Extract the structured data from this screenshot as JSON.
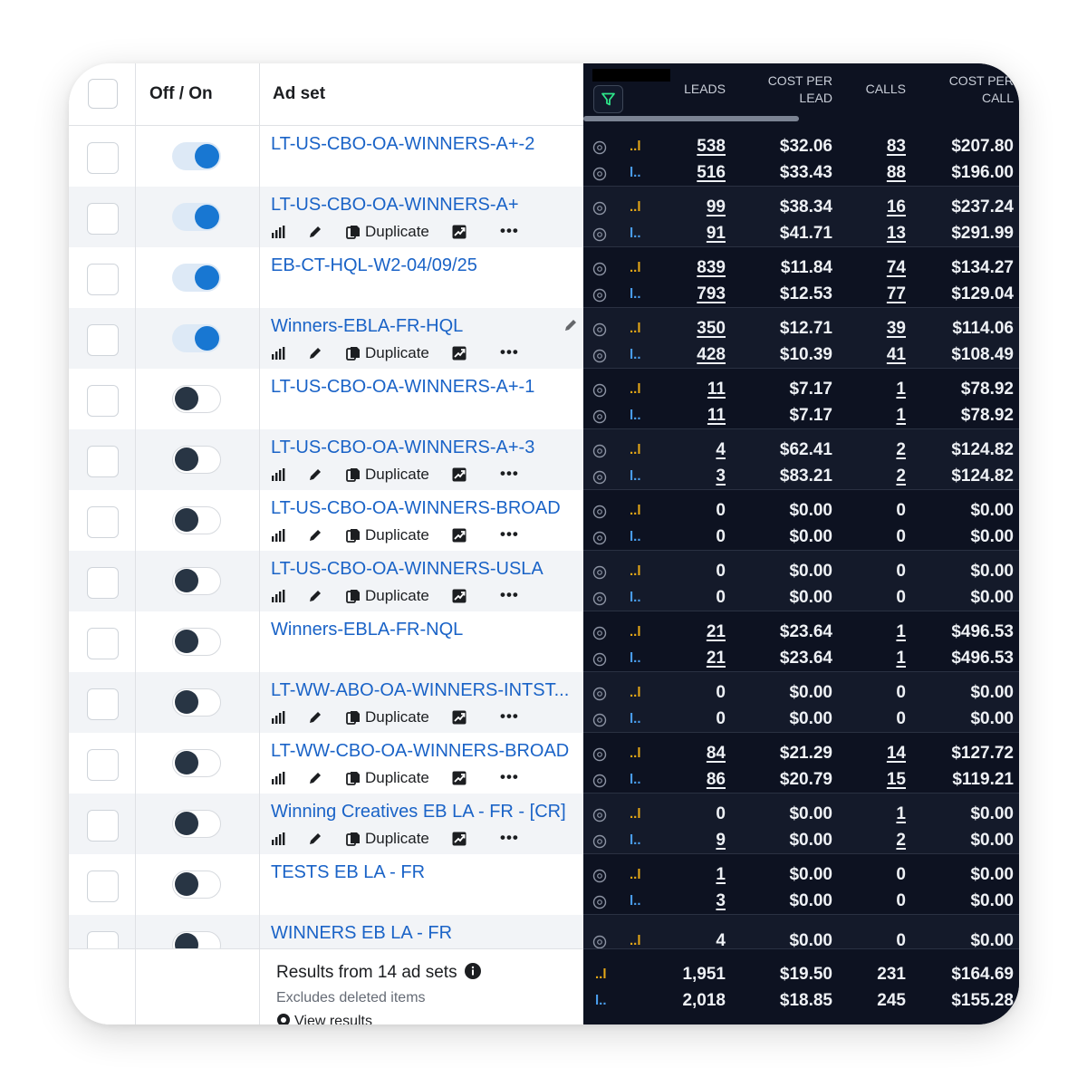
{
  "header": {
    "col_toggle": "Off / On",
    "col_adset": "Ad set",
    "col_leads": "LEADS",
    "col_cpl": [
      "COST PER",
      "LEAD"
    ],
    "col_calls": "CALLS",
    "col_cpc": [
      "COST PER",
      "CALL"
    ]
  },
  "actions": {
    "duplicate": "Duplicate",
    "more": "•••"
  },
  "legend": {
    "a": "..l",
    "b": "l.."
  },
  "rows": [
    {
      "name": "LT-US-CBO-OA-WINNERS-A+-2",
      "on": true,
      "tools": false,
      "a": {
        "leads": "538",
        "cpl": "$32.06",
        "calls": "83",
        "cpc": "$207.80"
      },
      "b": {
        "leads": "516",
        "cpl": "$33.43",
        "calls": "88",
        "cpc": "$196.00"
      }
    },
    {
      "name": "LT-US-CBO-OA-WINNERS-A+",
      "on": true,
      "tools": true,
      "a": {
        "leads": "99",
        "cpl": "$38.34",
        "calls": "16",
        "cpc": "$237.24"
      },
      "b": {
        "leads": "91",
        "cpl": "$41.71",
        "calls": "13",
        "cpc": "$291.99"
      }
    },
    {
      "name": "EB-CT-HQL-W2-04/09/25",
      "on": true,
      "tools": false,
      "a": {
        "leads": "839",
        "cpl": "$11.84",
        "calls": "74",
        "cpc": "$134.27"
      },
      "b": {
        "leads": "793",
        "cpl": "$12.53",
        "calls": "77",
        "cpc": "$129.04"
      }
    },
    {
      "name": "Winners-EBLA-FR-HQL",
      "on": true,
      "tools": true,
      "a": {
        "leads": "350",
        "cpl": "$12.71",
        "calls": "39",
        "cpc": "$114.06"
      },
      "b": {
        "leads": "428",
        "cpl": "$10.39",
        "calls": "41",
        "cpc": "$108.49"
      }
    },
    {
      "name": "LT-US-CBO-OA-WINNERS-A+-1",
      "on": false,
      "tools": false,
      "a": {
        "leads": "11",
        "cpl": "$7.17",
        "calls": "1",
        "cpc": "$78.92"
      },
      "b": {
        "leads": "11",
        "cpl": "$7.17",
        "calls": "1",
        "cpc": "$78.92"
      }
    },
    {
      "name": "LT-US-CBO-OA-WINNERS-A+-3",
      "on": false,
      "tools": true,
      "a": {
        "leads": "4",
        "cpl": "$62.41",
        "calls": "2",
        "cpc": "$124.82"
      },
      "b": {
        "leads": "3",
        "cpl": "$83.21",
        "calls": "2",
        "cpc": "$124.82"
      }
    },
    {
      "name": "LT-US-CBO-OA-WINNERS-BROAD",
      "on": false,
      "tools": true,
      "a": {
        "leads": "0",
        "cpl": "$0.00",
        "calls": "0",
        "cpc": "$0.00"
      },
      "b": {
        "leads": "0",
        "cpl": "$0.00",
        "calls": "0",
        "cpc": "$0.00"
      }
    },
    {
      "name": "LT-US-CBO-OA-WINNERS-USLA",
      "on": false,
      "tools": true,
      "a": {
        "leads": "0",
        "cpl": "$0.00",
        "calls": "0",
        "cpc": "$0.00"
      },
      "b": {
        "leads": "0",
        "cpl": "$0.00",
        "calls": "0",
        "cpc": "$0.00"
      }
    },
    {
      "name": "Winners-EBLA-FR-NQL",
      "on": false,
      "tools": false,
      "a": {
        "leads": "21",
        "cpl": "$23.64",
        "calls": "1",
        "cpc": "$496.53"
      },
      "b": {
        "leads": "21",
        "cpl": "$23.64",
        "calls": "1",
        "cpc": "$496.53"
      }
    },
    {
      "name": "LT-WW-ABO-OA-WINNERS-INTST...",
      "on": false,
      "tools": true,
      "a": {
        "leads": "0",
        "cpl": "$0.00",
        "calls": "0",
        "cpc": "$0.00"
      },
      "b": {
        "leads": "0",
        "cpl": "$0.00",
        "calls": "0",
        "cpc": "$0.00"
      }
    },
    {
      "name": "LT-WW-CBO-OA-WINNERS-BROAD",
      "on": false,
      "tools": true,
      "a": {
        "leads": "84",
        "cpl": "$21.29",
        "calls": "14",
        "cpc": "$127.72"
      },
      "b": {
        "leads": "86",
        "cpl": "$20.79",
        "calls": "15",
        "cpc": "$119.21"
      }
    },
    {
      "name": "Winning Creatives EB LA - FR - [CR]",
      "on": false,
      "tools": true,
      "a": {
        "leads": "0",
        "cpl": "$0.00",
        "calls": "1",
        "cpc": "$0.00"
      },
      "b": {
        "leads": "9",
        "cpl": "$0.00",
        "calls": "2",
        "cpc": "$0.00"
      }
    },
    {
      "name": "TESTS EB LA - FR",
      "on": false,
      "tools": false,
      "a": {
        "leads": "1",
        "cpl": "$0.00",
        "calls": "0",
        "cpc": "$0.00"
      },
      "b": {
        "leads": "3",
        "cpl": "$0.00",
        "calls": "0",
        "cpc": "$0.00"
      }
    },
    {
      "name": "WINNERS EB LA - FR",
      "on": false,
      "tools": false,
      "a": {
        "leads": "4",
        "cpl": "$0.00",
        "calls": "0",
        "cpc": "$0.00"
      },
      "b": null
    }
  ],
  "footer": {
    "title": "Results from 14 ad sets",
    "subtitle": "Excludes deleted items",
    "view": "View results",
    "a": {
      "leads": "1,951",
      "cpl": "$19.50",
      "calls": "231",
      "cpc": "$164.69"
    },
    "b": {
      "leads": "2,018",
      "cpl": "$18.85",
      "calls": "245",
      "cpc": "$155.28"
    }
  },
  "colors": {
    "link": "#1a63c7",
    "toggle_on": "#1877d2",
    "toggle_off_knob": "#283544",
    "metric_bg": "#0d1221",
    "label_a": "#e6a817",
    "label_b": "#4a9ff0"
  }
}
